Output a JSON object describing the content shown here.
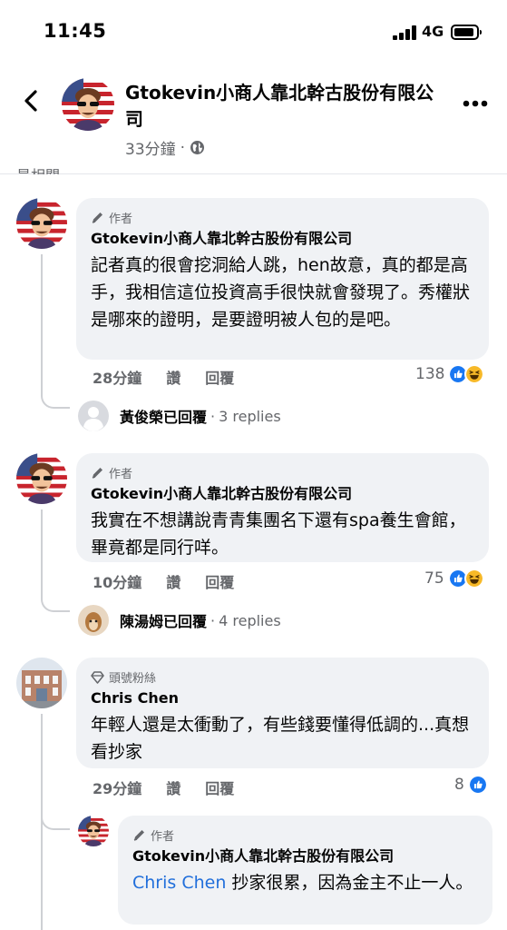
{
  "status_bar": {
    "time": "11:45",
    "network": "4G",
    "battery_level": 0.85
  },
  "header": {
    "page_name": "Gtokevin小商人靠北幹古股份有限公司",
    "time_ago": "33分鐘",
    "separator": "·",
    "cut_text": "最相關"
  },
  "comments": [
    {
      "badge": "作者",
      "author": "Gtokevin小商人靠北幹古股份有限公司",
      "text": "記者真的很會挖洞給人跳，hen故意，真的都是高手，我相信這位投資高手很快就會發現了。秀權狀是哪來的證明，是要證明被人包的是吧。",
      "time": "28分鐘",
      "like_label": "讚",
      "reply_label": "回覆",
      "reaction_count": "138",
      "reply_summary": {
        "name": "黃俊榮已回覆",
        "sep": "·",
        "count": "3 replies"
      }
    },
    {
      "badge": "作者",
      "author": "Gtokevin小商人靠北幹古股份有限公司",
      "text": "我實在不想講說青青集團名下還有spa養生會館，畢竟都是同行咩。",
      "time": "10分鐘",
      "like_label": "讚",
      "reply_label": "回覆",
      "reaction_count": "75",
      "reply_summary": {
        "name": "陳湯姆已回覆",
        "sep": "·",
        "count": "4 replies"
      }
    },
    {
      "badge": "頭號粉絲",
      "author": "Chris Chen",
      "text": "年輕人還是太衝動了，有些錢要懂得低調的...真想看抄家",
      "time": "29分鐘",
      "like_label": "讚",
      "reply_label": "回覆",
      "reaction_count": "8"
    }
  ],
  "nested_reply": {
    "badge": "作者",
    "author": "Gtokevin小商人靠北幹古股份有限公司",
    "mention": "Chris Chen",
    "text": " 抄家很累，因為金主不止一人。"
  },
  "icons": {
    "back": "chevron-left-icon",
    "more": "more-horizontal-icon",
    "globe": "globe-icon",
    "author_badge": "pencil-icon",
    "fan_badge": "diamond-icon",
    "like_reaction": "like-icon",
    "haha_reaction": "haha-icon"
  },
  "colors": {
    "link": "#216fdb",
    "like_blue": "#1877f2",
    "haha_yellow": "#f7b928",
    "bubble": "#f0f2f5",
    "meta": "#65676b"
  }
}
